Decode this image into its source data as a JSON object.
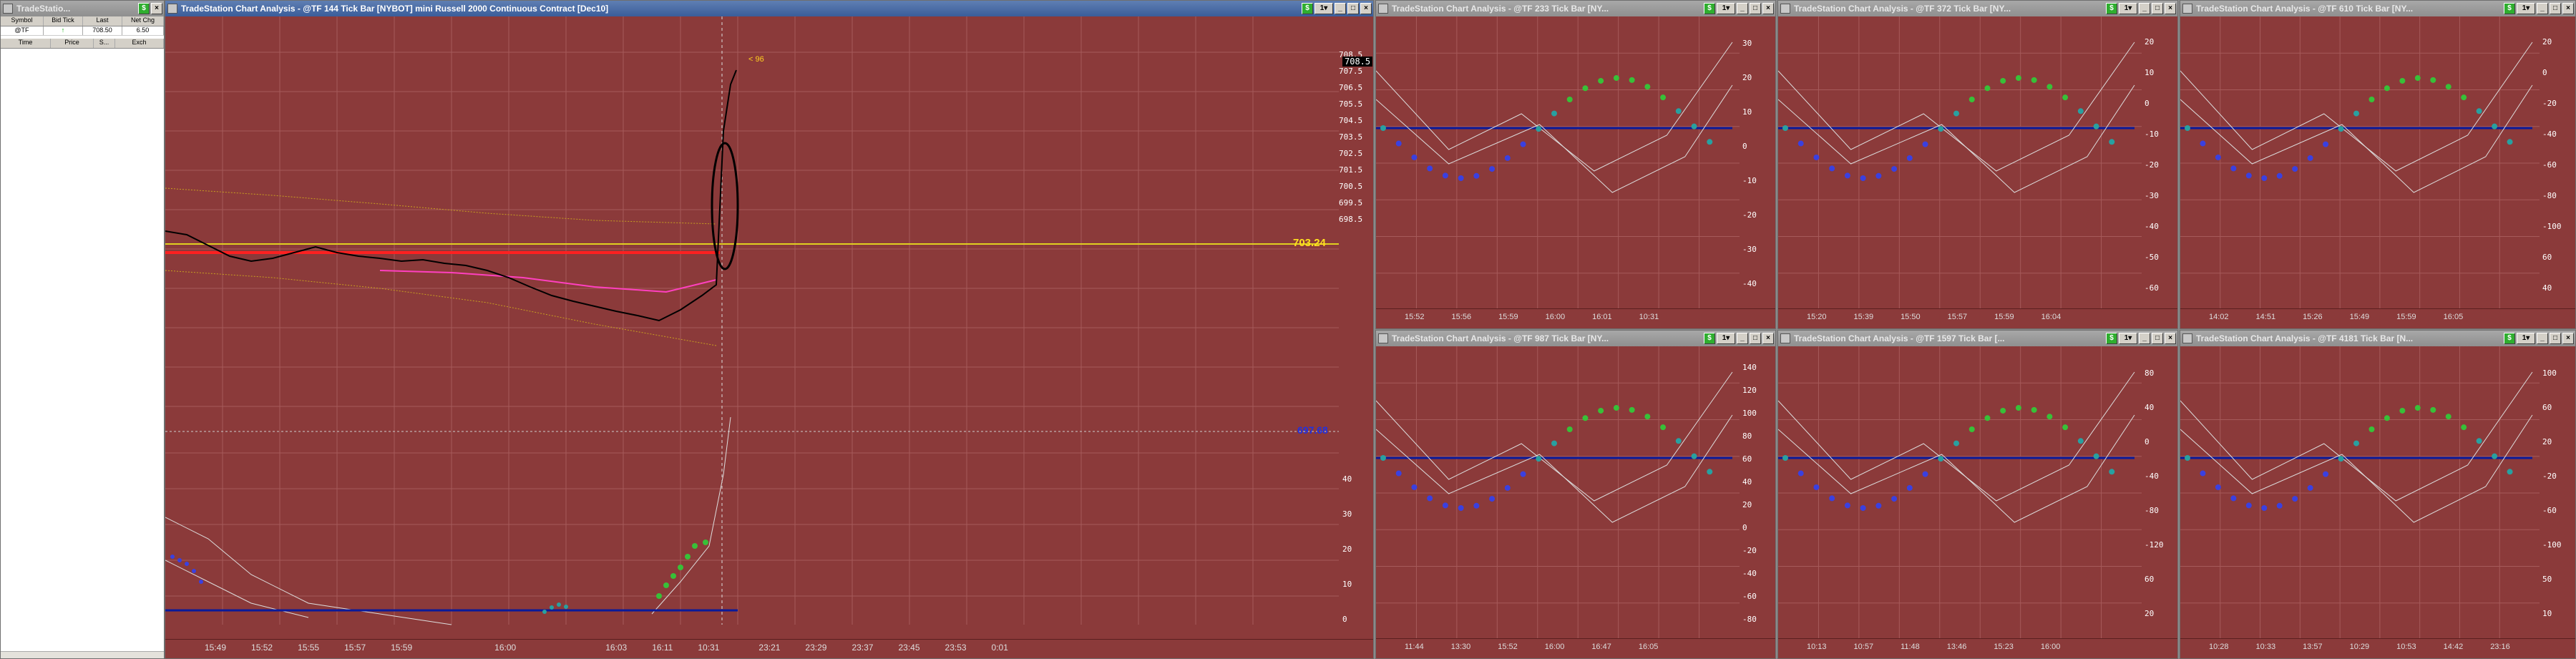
{
  "quote_window": {
    "title": "TradeStatio...",
    "columns": [
      "Symbol",
      "Bid Tick",
      "Last",
      "Net Chg"
    ],
    "row": {
      "symbol": "@TF",
      "bid_tick": "↑",
      "last": "708.50",
      "net_chg": "6.50"
    },
    "ts_columns": [
      "Time",
      "Price",
      "S...",
      "Exch"
    ]
  },
  "main_chart": {
    "title": "TradeStation Chart Analysis - @TF 144 Tick Bar [NYBOT] mini Russell 2000 Continuous Contract [Dec10]",
    "price_axis": [
      "708.5",
      "707.5",
      "706.5",
      "705.5",
      "704.5",
      "703.5",
      "702.5",
      "701.5",
      "700.5",
      "699.5",
      "698.5"
    ],
    "last_price_label": "708.5",
    "yellow_level_label": "703.24",
    "blue_level_label": "697.68",
    "arrow_label": "< 96",
    "indicator_axis": [
      "40",
      "30",
      "20",
      "10",
      "0"
    ],
    "time_axis": [
      "15:49",
      "15:52",
      "15:55",
      "15:57",
      "15:59",
      "16:00",
      "16:03",
      "16:11",
      "10:31",
      "23:21",
      "23:29",
      "23:37",
      "23:45",
      "23:53",
      "0:01"
    ]
  },
  "panels": [
    {
      "id": "233",
      "title": "TradeStation Chart Analysis - @TF 233 Tick Bar [NY...",
      "axis": [
        "30",
        "20",
        "10",
        "0",
        "-10",
        "-20",
        "-30",
        "-40"
      ],
      "time": [
        "15:52",
        "15:56",
        "15:59",
        "16:00",
        "16:01",
        "10:31"
      ]
    },
    {
      "id": "372",
      "title": "TradeStation Chart Analysis - @TF 372 Tick Bar [NY...",
      "axis": [
        "20",
        "10",
        "0",
        "-10",
        "-20",
        "-30",
        "-40",
        "-50",
        "-60"
      ],
      "time": [
        "15:20",
        "15:39",
        "15:50",
        "15:57",
        "15:59",
        "16:04"
      ]
    },
    {
      "id": "610",
      "title": "TradeStation Chart Analysis - @TF 610 Tick Bar [NY...",
      "axis": [
        "20",
        "0",
        "-20",
        "-40",
        "-60",
        "-80",
        "-100",
        "60",
        "40"
      ],
      "time": [
        "14:02",
        "14:51",
        "15:26",
        "15:49",
        "15:59",
        "16:05"
      ]
    },
    {
      "id": "987",
      "title": "TradeStation Chart Analysis - @TF 987 Tick Bar [NY...",
      "axis": [
        "140",
        "120",
        "100",
        "80",
        "60",
        "40",
        "20",
        "0",
        "-20",
        "-40",
        "-60",
        "-80"
      ],
      "time": [
        "11:44",
        "13:30",
        "15:52",
        "16:00",
        "16:47",
        "16:05"
      ]
    },
    {
      "id": "1597",
      "title": "TradeStation Chart Analysis - @TF 1597 Tick Bar [...",
      "axis": [
        "80",
        "40",
        "0",
        "-40",
        "-80",
        "-120",
        "60",
        "20"
      ],
      "time": [
        "10:13",
        "10:57",
        "11:48",
        "13:46",
        "15:23",
        "16:00"
      ]
    },
    {
      "id": "4181",
      "title": "TradeStation Chart Analysis - @TF 4181 Tick Bar [N...",
      "axis": [
        "100",
        "60",
        "20",
        "-20",
        "-60",
        "-100",
        "50",
        "10"
      ],
      "time": [
        "10:28",
        "10:33",
        "13:57",
        "10:29",
        "10:53",
        "14:42",
        "23:16"
      ]
    }
  ]
}
